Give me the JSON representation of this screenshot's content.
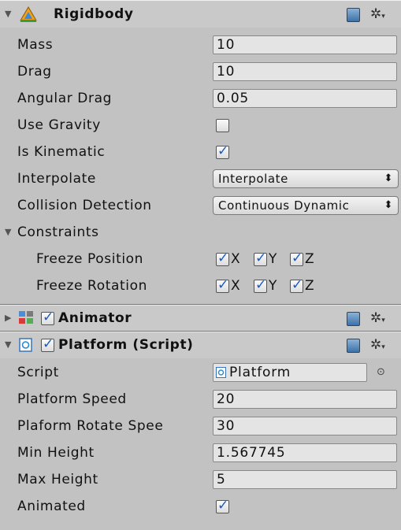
{
  "rigidbody": {
    "title": "Rigidbody",
    "fields": [
      {
        "label": "Mass",
        "value": "10"
      },
      {
        "label": "Drag",
        "value": "10"
      },
      {
        "label": "Angular Drag",
        "value": "0.05"
      }
    ],
    "use_gravity": {
      "label": "Use Gravity",
      "checked": false
    },
    "is_kinematic": {
      "label": "Is Kinematic",
      "checked": true
    },
    "interpolate": {
      "label": "Interpolate",
      "value": "Interpolate"
    },
    "collision_detection": {
      "label": "Collision Detection",
      "value": "Continuous Dynamic"
    },
    "constraints": {
      "label": "Constraints",
      "freeze_position": {
        "label": "Freeze Position",
        "x": "X",
        "y": "Y",
        "z": "Z"
      },
      "freeze_rotation": {
        "label": "Freeze Rotation",
        "x": "X",
        "y": "Y",
        "z": "Z"
      }
    }
  },
  "animator": {
    "title": "Animator",
    "enabled": true
  },
  "platform": {
    "title": "Platform (Script)",
    "enabled": true,
    "script": {
      "label": "Script",
      "value": "Platform"
    },
    "fields": [
      {
        "label": "Platform Speed",
        "value": "20"
      },
      {
        "label": "Plaform Rotate Spee",
        "value": "30"
      },
      {
        "label": "Min Height",
        "value": "1.567745"
      },
      {
        "label": "Max Height",
        "value": "5"
      }
    ],
    "animated": {
      "label": "Animated",
      "checked": true
    }
  },
  "icons": {
    "rigidbody": "rigidbody-icon",
    "animator": "animator-icon",
    "script": "script-icon",
    "help": "help-book-icon",
    "settings": "gear-icon"
  },
  "dropdown_arrow": "⬍",
  "check_glyph": "✓"
}
